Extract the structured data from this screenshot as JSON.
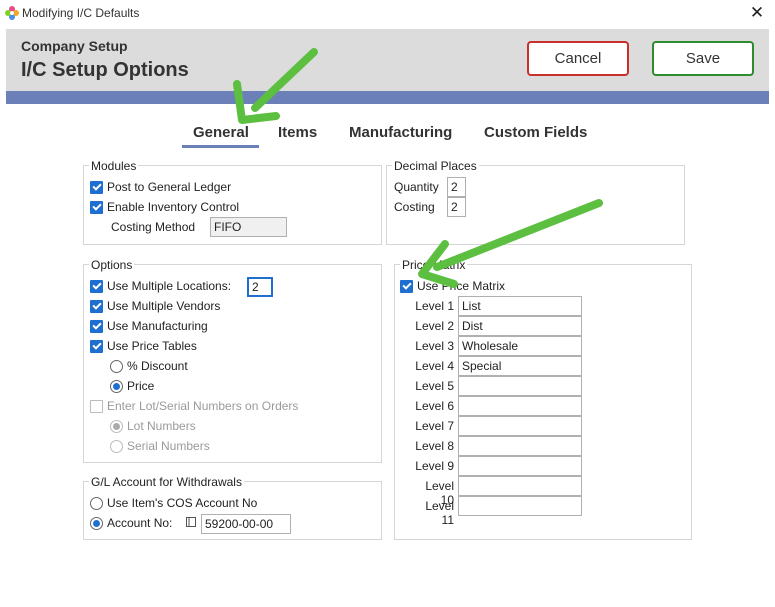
{
  "window": {
    "title": "Modifying I/C Defaults"
  },
  "header": {
    "subtitle": "Company Setup",
    "title": "I/C Setup Options",
    "cancel_label": "Cancel",
    "save_label": "Save"
  },
  "tabs": [
    {
      "label": "General",
      "active": true
    },
    {
      "label": "Items"
    },
    {
      "label": "Manufacturing"
    },
    {
      "label": "Custom Fields"
    }
  ],
  "modules": {
    "title": "Modules",
    "post_gl": {
      "label": "Post to General Ledger",
      "checked": true
    },
    "enable_inventory": {
      "label": "Enable Inventory Control",
      "checked": true
    },
    "costing_method_label": "Costing Method",
    "costing_method_value": "FIFO"
  },
  "decimal": {
    "title": "Decimal Places",
    "quantity_label": "Quantity",
    "quantity_value": "2",
    "costing_label": "Costing",
    "costing_value": "2"
  },
  "options": {
    "title": "Options",
    "multi_locations": {
      "label": "Use Multiple Locations:",
      "checked": true,
      "value": "2"
    },
    "multi_vendors": {
      "label": "Use Multiple Vendors",
      "checked": true
    },
    "manufacturing": {
      "label": "Use Manufacturing",
      "checked": true
    },
    "price_tables": {
      "label": "Use Price Tables",
      "checked": true
    },
    "pct_discount": {
      "label": "% Discount",
      "selected": false
    },
    "price": {
      "label": "Price",
      "selected": true
    },
    "lot_serial": {
      "label": "Enter Lot/Serial Numbers on Orders",
      "checked": false
    },
    "lot_numbers": {
      "label": "Lot Numbers",
      "selected": true
    },
    "serial_numbers": {
      "label": "Serial Numbers",
      "selected": false
    }
  },
  "gl": {
    "title": "G/L Account for Withdrawals",
    "use_cos": {
      "label": "Use Item's COS Account No",
      "selected": false
    },
    "account_no": {
      "label": "Account No:",
      "selected": true,
      "value": "59200-00-00"
    }
  },
  "price_matrix": {
    "title": "Price Matrix",
    "use": {
      "label": "Use Price Matrix",
      "checked": true
    },
    "levels": [
      {
        "label": "Level 1",
        "value": "List"
      },
      {
        "label": "Level 2",
        "value": "Dist"
      },
      {
        "label": "Level 3",
        "value": "Wholesale"
      },
      {
        "label": "Level 4",
        "value": "Special"
      },
      {
        "label": "Level 5",
        "value": ""
      },
      {
        "label": "Level 6",
        "value": ""
      },
      {
        "label": "Level 7",
        "value": ""
      },
      {
        "label": "Level 8",
        "value": ""
      },
      {
        "label": "Level 9",
        "value": ""
      },
      {
        "label": "Level 10",
        "value": ""
      },
      {
        "label": "Level 11",
        "value": ""
      }
    ]
  },
  "colors": {
    "accent": "#6b7fb8",
    "check": "#1e6fd0",
    "cancel_border": "#c9302c",
    "save_border": "#2e8b2e",
    "annotation_arrow": "#5cbf40"
  }
}
